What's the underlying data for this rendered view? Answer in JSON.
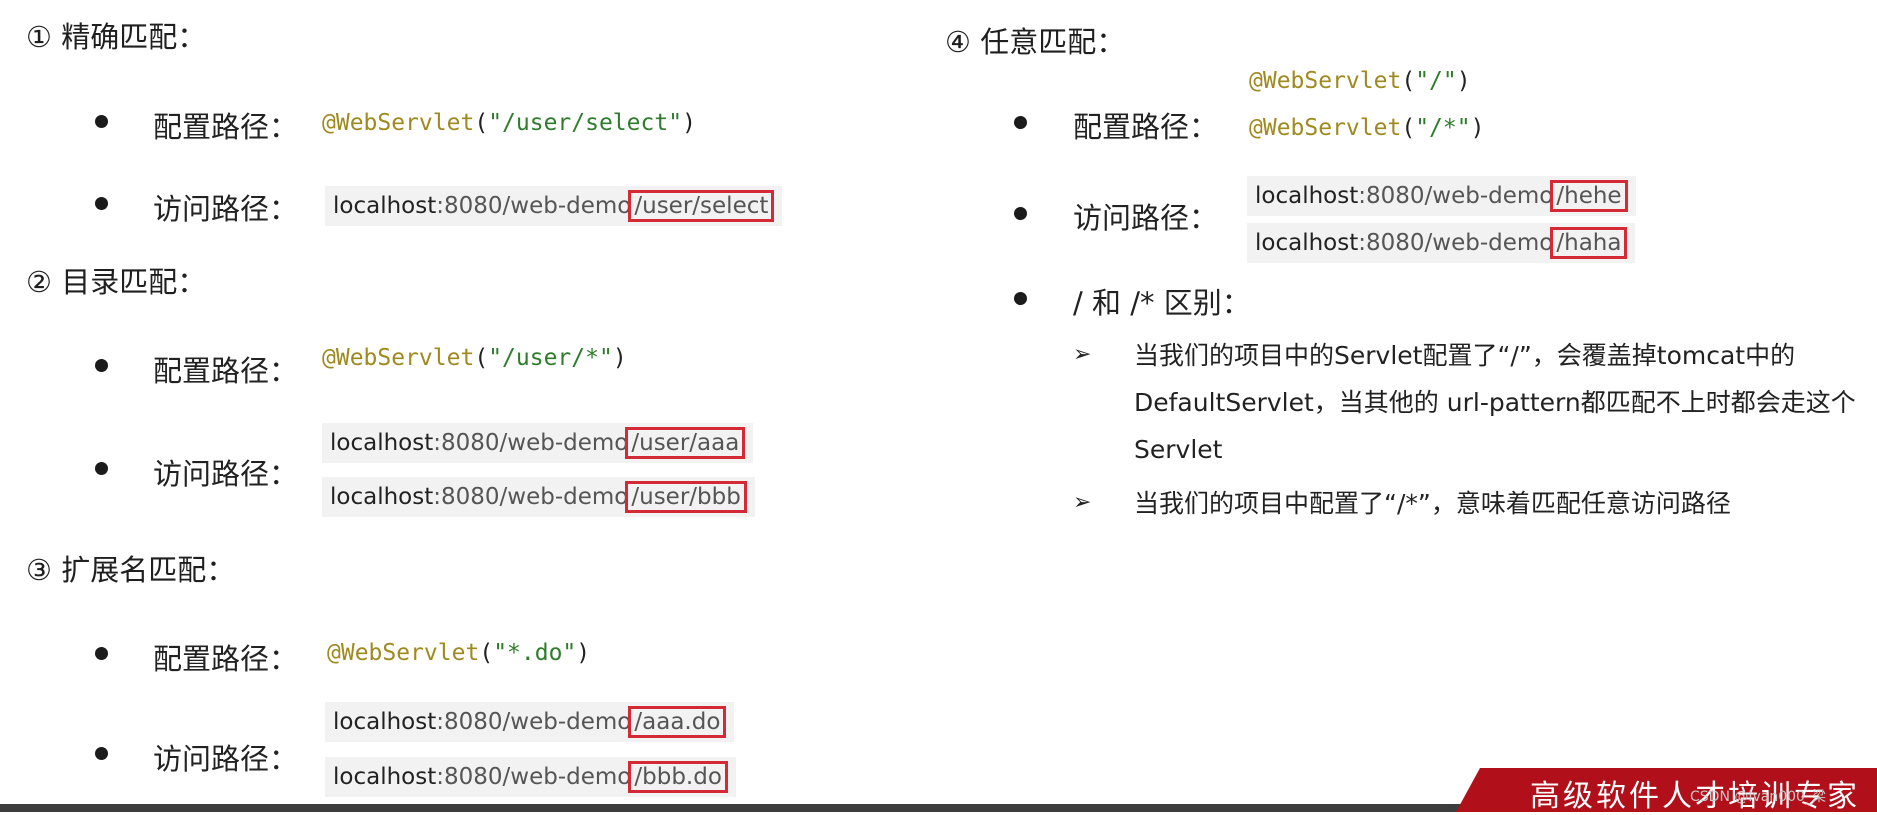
{
  "s1": {
    "heading": "① 精确匹配：",
    "config_label": "配置路径：",
    "code": {
      "ann": "@WebServlet",
      "open": "(",
      "str": "\"/user/select\"",
      "close": ")"
    },
    "access_label": "访问路径：",
    "url": {
      "host": "localhost",
      "rest": ":8080/web-demo",
      "hl": "/user/select"
    }
  },
  "s2": {
    "heading": "② 目录匹配：",
    "config_label": "配置路径：",
    "code": {
      "ann": "@WebServlet",
      "open": "(",
      "str": "\"/user/*\"",
      "close": ")"
    },
    "access_label": "访问路径：",
    "urls": [
      {
        "host": "localhost",
        "rest": ":8080/web-demo",
        "hl": "/user/aaa"
      },
      {
        "host": "localhost",
        "rest": ":8080/web-demo",
        "hl": "/user/bbb"
      }
    ]
  },
  "s3": {
    "heading": "③ 扩展名匹配：",
    "config_label": "配置路径：",
    "code": {
      "ann": "@WebServlet",
      "open": "(",
      "str": "\"*.do\"",
      "close": ")"
    },
    "access_label": "访问路径：",
    "urls": [
      {
        "host": "localhost",
        "rest": ":8080/web-demo",
        "hl": "/aaa.do"
      },
      {
        "host": "localhost",
        "rest": ":8080/web-demo",
        "hl": "/bbb.do"
      }
    ]
  },
  "s4": {
    "heading": "④ 任意匹配：",
    "config_label": "配置路径：",
    "codes": [
      {
        "ann": "@WebServlet",
        "open": "(",
        "str": "\"/\"",
        "close": ")"
      },
      {
        "ann": "@WebServlet",
        "open": "(",
        "str": "\"/*\"",
        "close": ")"
      }
    ],
    "access_label": "访问路径：",
    "urls": [
      {
        "host": "localhost",
        "rest": ":8080/web-demo",
        "hl": "/hehe"
      },
      {
        "host": "localhost",
        "rest": ":8080/web-demo",
        "hl": "/haha"
      }
    ],
    "diff_label": "/ 和 /* 区别：",
    "points": [
      "当我们的项目中的Servlet配置了“/”，会覆盖掉tomcat中的DefaultServlet，当其他的 url-pattern都匹配不上时都会走这个Servlet",
      "当我们的项目中配置了“/*”，意味着匹配任意访问路径"
    ],
    "arrow_glyph": "➢"
  },
  "banner": {
    "text": "高级软件人才培训专家",
    "watermark": "CSDN @Ivan000_梁"
  },
  "colors": {
    "highlight_box": "#d32a36",
    "banner": "#b1101b",
    "annotation": "#9e8a1f",
    "string": "#2f7d2c"
  }
}
